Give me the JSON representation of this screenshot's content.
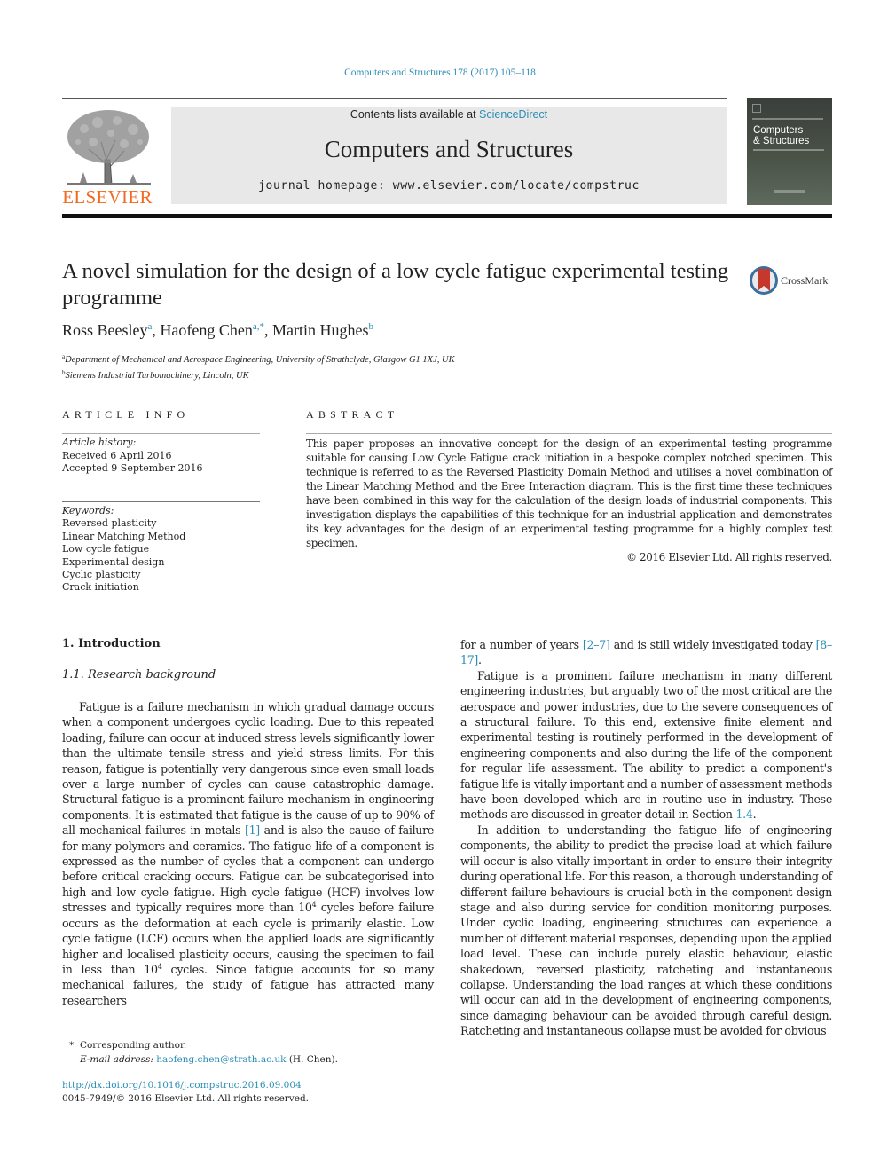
{
  "header": {
    "journal_reference": "Computers and Structures 178 (2017) 105–118",
    "contents_prefix": "Contents lists available at ",
    "contents_link": "ScienceDirect",
    "journal_title": "Computers and Structures",
    "homepage": "journal homepage: www.elsevier.com/locate/compstruc",
    "publisher_logo_text": "ELSEVIER",
    "cover": {
      "title_line1": "Computers",
      "title_line2": "& Structures"
    },
    "colors": {
      "link": "#2a8db5",
      "elsevier_orange": "#f26a21",
      "masthead_bg": "#e8e8e8"
    }
  },
  "article": {
    "title": "A novel simulation for the design of a low cycle fatigue experimental testing programme",
    "crossmark_label": "CrossMark",
    "authors": [
      {
        "name": "Ross Beesley",
        "marks": "a"
      },
      {
        "name": "Haofeng Chen",
        "marks": "a,*"
      },
      {
        "name": "Martin Hughes",
        "marks": "b"
      }
    ],
    "affiliations": [
      {
        "mark": "a",
        "text": "Department of Mechanical and Aerospace Engineering, University of Strathclyde, Glasgow G1 1XJ, UK"
      },
      {
        "mark": "b",
        "text": "Siemens Industrial Turbomachinery, Lincoln, UK"
      }
    ]
  },
  "article_info": {
    "heading": "ARTICLE INFO",
    "history_label": "Article history:",
    "received": "Received 6 April 2016",
    "accepted": "Accepted 9 September 2016",
    "keywords_label": "Keywords:",
    "keywords": [
      "Reversed plasticity",
      "Linear Matching Method",
      "Low cycle fatigue",
      "Experimental design",
      "Cyclic plasticity",
      "Crack initiation"
    ]
  },
  "abstract": {
    "heading": "ABSTRACT",
    "text": "This paper proposes an innovative concept for the design of an experimental testing programme suitable for causing Low Cycle Fatigue crack initiation in a bespoke complex notched specimen. This technique is referred to as the Reversed Plasticity Domain Method and utilises a novel combination of the Linear Matching Method and the Bree Interaction diagram. This is the first time these techniques have been combined in this way for the calculation of the design loads of industrial components. This investigation displays the capabilities of this technique for an industrial application and demonstrates its key advantages for the design of an experimental testing programme for a highly complex test specimen.",
    "copyright": "© 2016 Elsevier Ltd. All rights reserved."
  },
  "body": {
    "section_heading": "1. Introduction",
    "subsection_heading": "1.1. Research background",
    "left_column": {
      "p1_a": "Fatigue is a failure mechanism in which gradual damage occurs when a component undergoes cyclic loading. Due to this repeated loading, failure can occur at induced stress levels significantly lower than the ultimate tensile stress and yield stress limits. For this reason, fatigue is potentially very dangerous since even small loads over a large number of cycles can cause catastrophic damage. Structural fatigue is a prominent failure mechanism in engineering components. It is estimated that fatigue is the cause of up to 90% of all mechanical failures in metals ",
      "ref1": "[1]",
      "p1_b": " and is also the cause of failure for many polymers and ceramics. The fatigue life of a component is expressed as the number of cycles that a component can undergo before critical cracking occurs. Fatigue can be subcategorised into high and low cycle fatigue. High cycle fatigue (HCF) involves low stresses and typically requires more than 10",
      "exp1": "4",
      "p1_c": " cycles before failure occurs as the deformation at each cycle is primarily elastic. Low cycle fatigue (LCF) occurs when the applied loads are significantly higher and localised plasticity occurs, causing the specimen to fail in less than 10",
      "exp2": "4",
      "p1_d": " cycles. Since fatigue accounts for so many mechanical failures, the study of fatigue has attracted many researchers"
    },
    "right_column": {
      "cont_a": "for a number of years ",
      "ref2": "[2–7]",
      "cont_b": " and is still widely investigated today ",
      "ref3": "[8–17]",
      "cont_c": ".",
      "p2_a": "Fatigue is a prominent failure mechanism in many different engineering industries, but arguably two of the most critical are the aerospace and power industries, due to the severe consequences of a structural failure. To this end, extensive finite element and experimental testing is routinely performed in the development of engineering components and also during the life of the component for regular life assessment. The ability to predict a component's fatigue life is vitally important and a number of assessment methods have been developed which are in routine use in industry. These methods are discussed in greater detail in Section ",
      "ref4": "1.4",
      "p2_b": ".",
      "p3": "In addition to understanding the fatigue life of engineering components, the ability to predict the precise load at which failure will occur is also vitally important in order to ensure their integrity during operational life. For this reason, a thorough understanding of different failure behaviours is crucial both in the component design stage and also during service for condition monitoring purposes. Under cyclic loading, engineering structures can experience a number of different material responses, depending upon the applied load level. These can include purely elastic behaviour, elastic shakedown, reversed plasticity, ratcheting and instantaneous collapse. Understanding the load ranges at which these conditions will occur can aid in the development of engineering components, since damaging behaviour can be avoided through careful design. Ratcheting and instantaneous collapse must be avoided for obvious"
    }
  },
  "footer": {
    "corresponding_mark": "*",
    "corresponding_text": "Corresponding author.",
    "email_label": "E-mail address:",
    "email": "haofeng.chen@strath.ac.uk",
    "email_suffix": "(H. Chen).",
    "doi": "http://dx.doi.org/10.1016/j.compstruc.2016.09.004",
    "issn_copyright": "0045-7949/© 2016 Elsevier Ltd. All rights reserved."
  }
}
